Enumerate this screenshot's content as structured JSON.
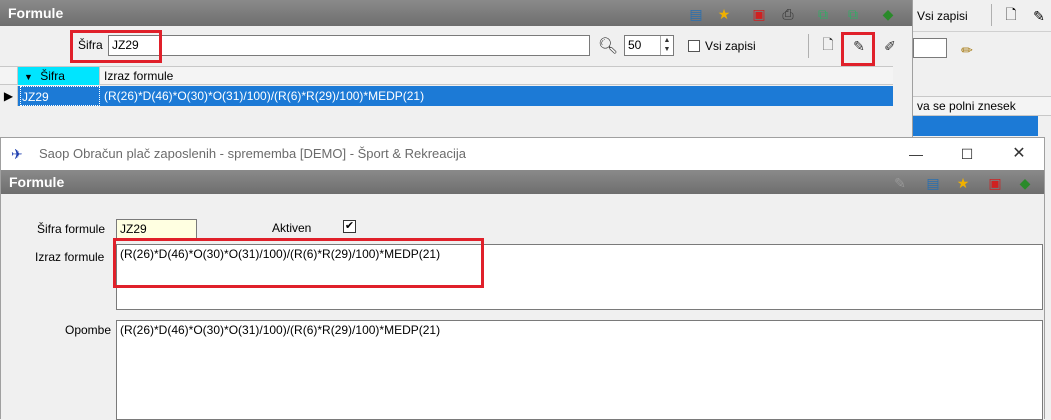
{
  "list_window": {
    "title": "Formule",
    "search_label": "Šifra",
    "search_value": "JZ29",
    "page_size": "50",
    "all_records_label": "Vsi zapisi",
    "columns": [
      "Šifra",
      "Izraz formule"
    ],
    "rows": [
      {
        "code": "JZ29",
        "formula": "(R(26)*D(46)*O(30)*O(31)/100)/(R(6)*R(29)/100)*MEDP(21)"
      }
    ]
  },
  "right_window": {
    "all_records_label": "Vsi zapisi",
    "column_fragment": "va se polni znesek"
  },
  "dialog": {
    "window_title": "Saop Obračun plač zaposlenih - sprememba [DEMO] - Šport & Rekreacija",
    "header": "Formule",
    "code_label": "Šifra formule",
    "code_value": "JZ29",
    "active_label": "Aktiven",
    "active_checked": "✔",
    "formula_label": "Izraz formule",
    "formula_value": "(R(26)*D(46)*O(30)*O(31)/100)/(R(6)*R(29)/100)*MEDP(21)",
    "notes_label": "Opombe",
    "notes_value": "(R(26)*D(46)*O(30)*O(31)/100)/(R(6)*R(29)/100)*MEDP(21)"
  },
  "colors": {
    "highlight": "#e0202a",
    "selection": "#1c7ad6",
    "header_cyan": "#00e5ff"
  }
}
